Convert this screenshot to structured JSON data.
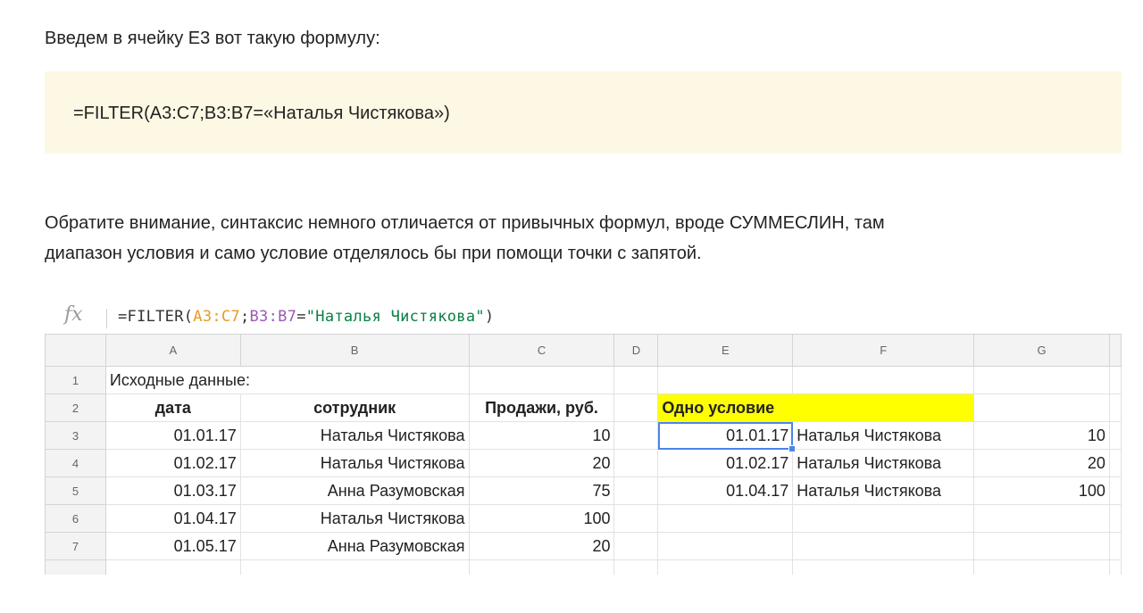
{
  "article": {
    "intro": "Введем в ячейку E3 вот такую формулу:",
    "code": "=FILTER(A3:C7;B3:B7=«Наталья Чистякова»)",
    "paragraph_line1": "Обратите внимание, синтаксис немного отличается от привычных формул, вроде СУММЕСЛИН, там",
    "paragraph_line2": "диапазон условия и само условие отделялось бы при помощи точки с запятой."
  },
  "formula_bar": {
    "icon": "fx-icon",
    "prefix": "=FILTER(",
    "range_a": "A3:C7",
    "sep": ";",
    "range_b": "B3:B7",
    "eq": "=",
    "criteria": "\"Наталья Чистякова\"",
    "suffix": ")"
  },
  "sheet": {
    "columns": [
      "A",
      "B",
      "C",
      "D",
      "E",
      "F",
      "G"
    ],
    "rows": [
      {
        "num": "1",
        "A": "Исходные данные:",
        "B": "",
        "C": "",
        "D": "",
        "E": "",
        "F": "",
        "G": ""
      },
      {
        "num": "2",
        "A": "дата",
        "B": "сотрудник",
        "C": "Продажи, руб.",
        "D": "",
        "E": "Одно условие",
        "F": "",
        "G": ""
      },
      {
        "num": "3",
        "A": "01.01.17",
        "B": "Наталья Чистякова",
        "C": "10",
        "D": "",
        "E": "01.01.17",
        "F": "Наталья Чистякова",
        "G": "10"
      },
      {
        "num": "4",
        "A": "01.02.17",
        "B": "Наталья Чистякова",
        "C": "20",
        "D": "",
        "E": "01.02.17",
        "F": "Наталья Чистякова",
        "G": "20"
      },
      {
        "num": "5",
        "A": "01.03.17",
        "B": "Анна Разумовская",
        "C": "75",
        "D": "",
        "E": "01.04.17",
        "F": "Наталья Чистякова",
        "G": "100"
      },
      {
        "num": "6",
        "A": "01.04.17",
        "B": "Наталья Чистякова",
        "C": "100",
        "D": "",
        "E": "",
        "F": "",
        "G": ""
      },
      {
        "num": "7",
        "A": "01.05.17",
        "B": "Анна Разумовская",
        "C": "20",
        "D": "",
        "E": "",
        "F": "",
        "G": ""
      }
    ],
    "selected_cell": "E3",
    "highlight_color": "#ffff00",
    "selection_color": "#4a86e8"
  }
}
